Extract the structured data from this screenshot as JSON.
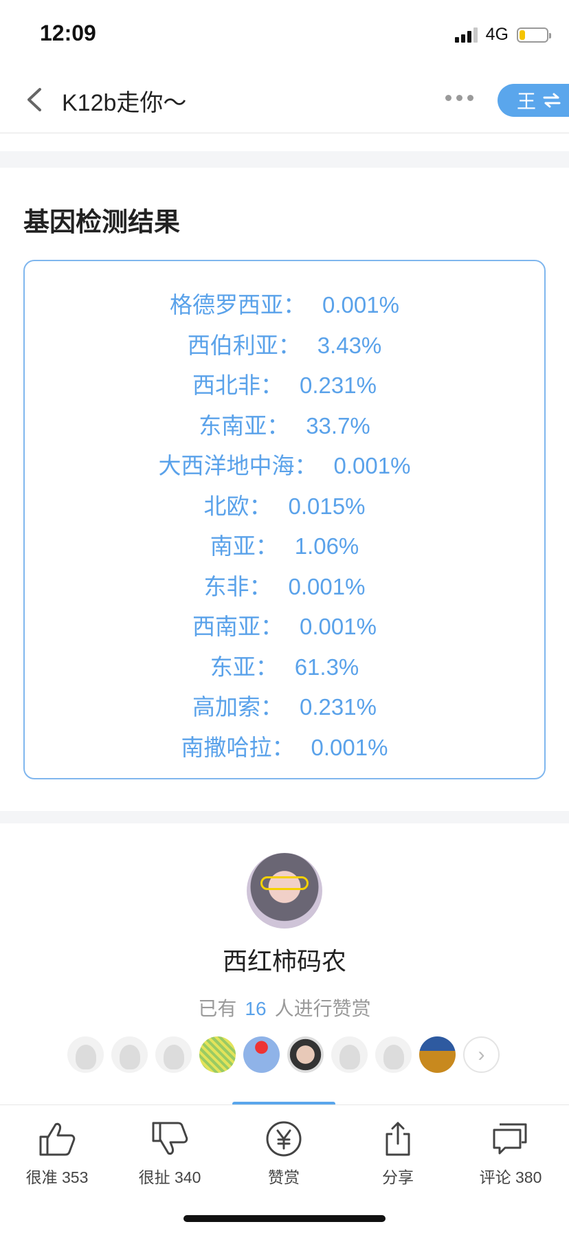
{
  "status_bar": {
    "time": "12:09",
    "network": "4G",
    "battery_level": 0.2,
    "signal_bars": 3
  },
  "nav": {
    "title": "K12b走你～",
    "switch_label": "王"
  },
  "section": {
    "title": "基因检测结果"
  },
  "results": [
    {
      "region": "格德罗西亚：",
      "value": "0.001%"
    },
    {
      "region": "西伯利亚：",
      "value": "3.43%"
    },
    {
      "region": "西北非：",
      "value": "0.231%"
    },
    {
      "region": "东南亚：",
      "value": "33.7%"
    },
    {
      "region": "大西洋地中海：",
      "value": "0.001%"
    },
    {
      "region": "北欧：",
      "value": "0.015%"
    },
    {
      "region": "南亚：",
      "value": "1.06%"
    },
    {
      "region": "东非：",
      "value": "0.001%"
    },
    {
      "region": "西南亚：",
      "value": "0.001%"
    },
    {
      "region": "东亚：",
      "value": "61.3%"
    },
    {
      "region": "高加索：",
      "value": "0.231%"
    },
    {
      "region": "南撒哈拉：",
      "value": "0.001%"
    }
  ],
  "author": {
    "name": "西红柿码农"
  },
  "reward": {
    "prefix": "已有",
    "count": "16",
    "suffix": "人进行赞赏"
  },
  "supporters": [
    "default",
    "default",
    "default",
    "qr",
    "snow",
    "face",
    "default",
    "default",
    "castle"
  ],
  "bottom_bar": {
    "like": "很准 353",
    "dislike": "很扯 340",
    "reward": "赞赏",
    "share": "分享",
    "comment": "评论 380"
  },
  "colors": {
    "accent": "#5aa2ea",
    "border": "#7fb6ee",
    "switch_bg": "#5aa6ec"
  }
}
